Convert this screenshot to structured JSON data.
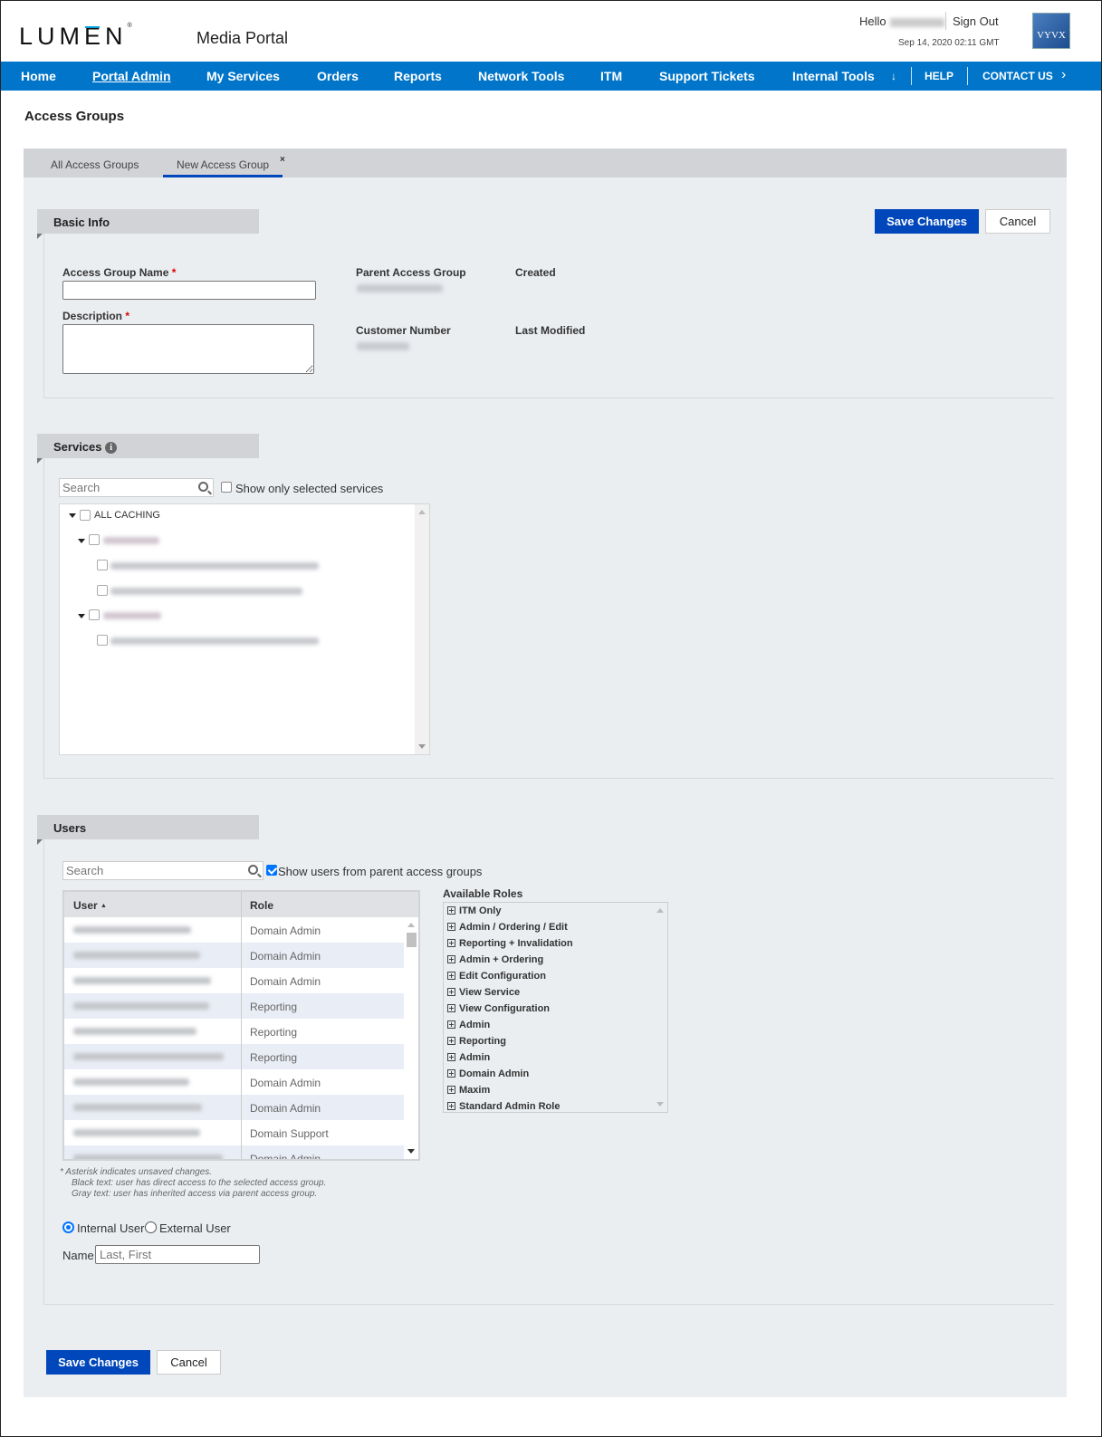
{
  "header": {
    "brand": "LUMEN",
    "portal_title": "Media Portal",
    "greeting": "Hello",
    "sign_out": "Sign Out",
    "datetime": "Sep 14, 2020 02:11 GMT",
    "partner_logo": "VYVX"
  },
  "nav": {
    "items": [
      {
        "label": "Home"
      },
      {
        "label": "Portal Admin",
        "active": true
      },
      {
        "label": "My Services"
      },
      {
        "label": "Orders"
      },
      {
        "label": "Reports"
      },
      {
        "label": "Network Tools"
      },
      {
        "label": "ITM"
      },
      {
        "label": "Support Tickets"
      },
      {
        "label": "Internal Tools"
      }
    ],
    "overflow_glyph": "↓",
    "help": "HELP",
    "contact": "CONTACT US",
    "contact_chevron": "›"
  },
  "page": {
    "title": "Access Groups",
    "tabs": [
      {
        "label": "All Access Groups"
      },
      {
        "label": "New Access Group",
        "active": true,
        "close_glyph": "×"
      }
    ]
  },
  "actions": {
    "save": "Save Changes",
    "cancel": "Cancel"
  },
  "basic_info": {
    "header": "Basic Info",
    "name_label": "Access Group Name",
    "name_value": "",
    "description_label": "Description",
    "description_value": "",
    "required_mark": "*",
    "parent_label": "Parent Access Group",
    "created_label": "Created",
    "customer_number_label": "Customer Number",
    "last_modified_label": "Last Modified"
  },
  "services": {
    "header": "Services",
    "info_glyph": "i",
    "search_placeholder": "Search",
    "show_selected_label": "Show only selected services",
    "show_selected_checked": false,
    "tree": [
      {
        "label": "ALL CACHING",
        "level": 0,
        "expanded": true,
        "checked": false
      },
      {
        "label": "",
        "level": 1,
        "expanded": true,
        "checked": false,
        "redacted": true
      },
      {
        "label": "",
        "level": 2,
        "checked": false,
        "redacted": true
      },
      {
        "label": "",
        "level": 2,
        "checked": false,
        "redacted": true
      },
      {
        "label": "",
        "level": 1,
        "expanded": true,
        "checked": false,
        "redacted": true
      },
      {
        "label": "",
        "level": 2,
        "checked": false,
        "redacted": true
      }
    ]
  },
  "users": {
    "header": "Users",
    "search_placeholder": "Search",
    "show_parent_label": "Show users from parent access groups",
    "show_parent_checked": true,
    "columns": [
      "User",
      "Role"
    ],
    "sort_glyph": "▲",
    "rows": [
      {
        "role": "Domain Admin"
      },
      {
        "role": "Domain Admin"
      },
      {
        "role": "Domain Admin"
      },
      {
        "role": "Reporting"
      },
      {
        "role": "Reporting"
      },
      {
        "role": "Reporting"
      },
      {
        "role": "Domain Admin"
      },
      {
        "role": "Domain Admin"
      },
      {
        "role": "Domain Support"
      },
      {
        "role": "Domain Admin"
      }
    ],
    "notes": [
      "* Asterisk indicates unsaved changes.",
      "Black text: user has direct access to the selected access group.",
      "Gray text: user has inherited access via parent access group."
    ],
    "user_type_options": [
      {
        "label": "Internal User",
        "selected": true
      },
      {
        "label": "External User",
        "selected": false
      }
    ],
    "name_label": "Name",
    "name_placeholder": "Last, First"
  },
  "roles": {
    "header": "Available Roles",
    "items": [
      "ITM Only",
      "Admin / Ordering / Edit",
      "Reporting + Invalidation",
      "Admin + Ordering",
      "Edit Configuration",
      "View Service",
      "View Configuration",
      "Admin",
      "Reporting",
      "Admin",
      "Domain Admin",
      "Maxim",
      "Standard Admin Role"
    ]
  },
  "colors": {
    "nav_bg": "#0075c9",
    "primary_button": "#0047bb",
    "panel_bg": "#ebeef1",
    "section_header_bg": "#d1d3d7",
    "required": "#dd0000"
  }
}
